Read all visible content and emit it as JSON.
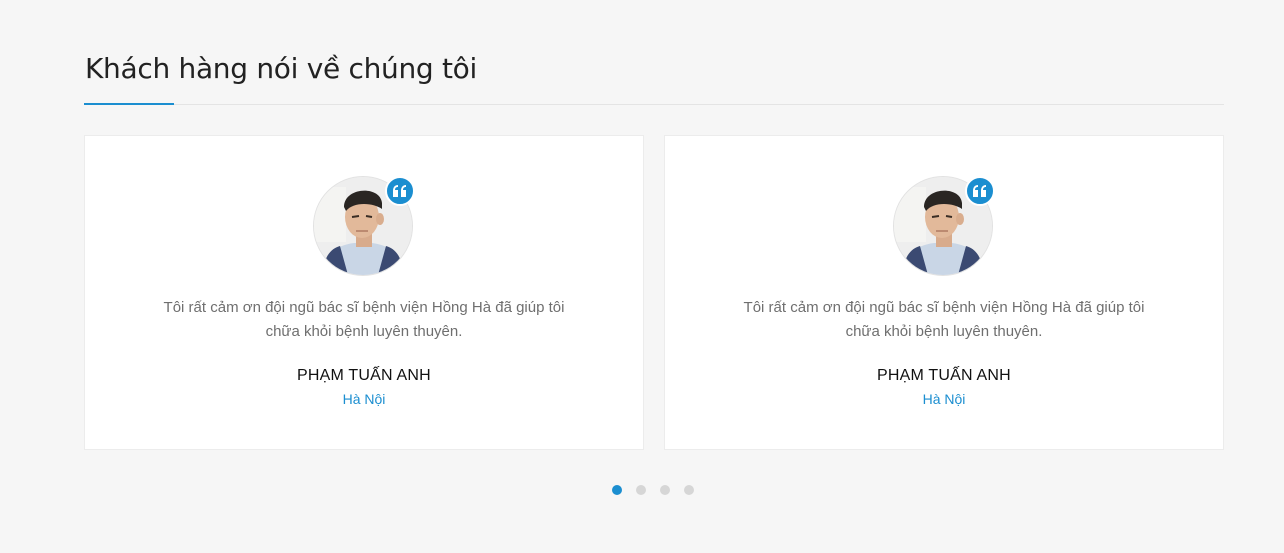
{
  "section": {
    "title": "Khách hàng nói về chúng tôi"
  },
  "colors": {
    "accent": "#1b8ed0",
    "background": "#f6f6f6",
    "card": "#ffffff"
  },
  "testimonials": [
    {
      "text": "Tôi rất cảm ơn đội ngũ bác sĩ bệnh viện Hồng Hà đã giúp tôi chữa khỏi bệnh luyên thuyên.",
      "name": "PHẠM TUẤN ANH",
      "location": "Hà Nội",
      "icon": "quote-icon"
    },
    {
      "text": "Tôi rất cảm ơn đội ngũ bác sĩ bệnh viện Hồng Hà đã giúp tôi chữa khỏi bệnh luyên thuyên.",
      "name": "PHẠM TUẤN ANH",
      "location": "Hà Nội",
      "icon": "quote-icon"
    }
  ],
  "pagination": {
    "count": 4,
    "active_index": 0
  }
}
